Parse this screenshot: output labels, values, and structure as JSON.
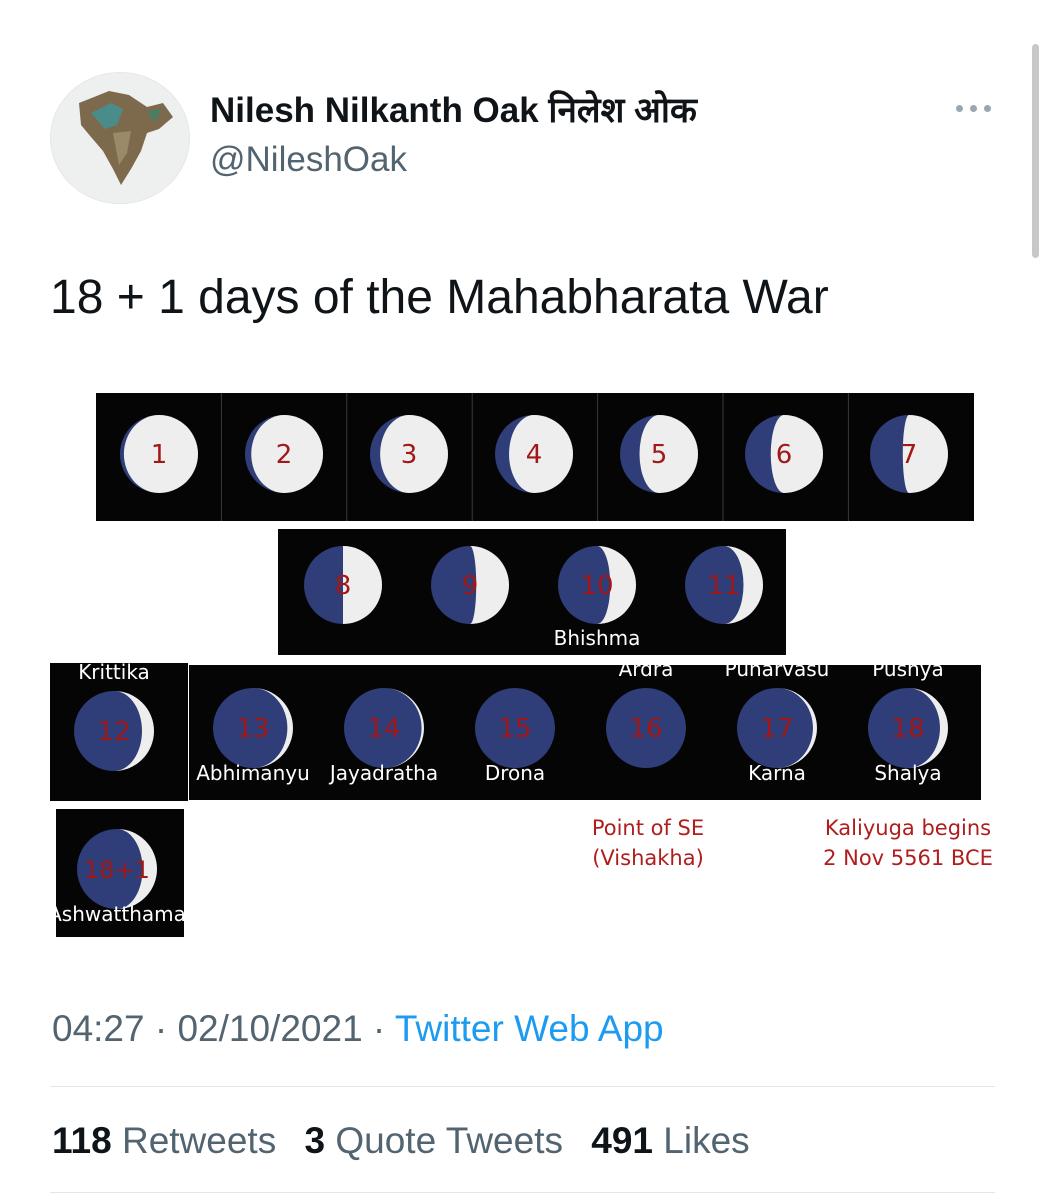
{
  "author": {
    "name": "Nilesh Nilkanth Oak निलेश ओक",
    "handle": "@NileshOak"
  },
  "tweet": {
    "text": "18 + 1 days of the Mahabharata War"
  },
  "image": {
    "moons": [
      {
        "label": "1",
        "phase": 0.05
      },
      {
        "label": "2",
        "phase": 0.08
      },
      {
        "label": "3",
        "phase": 0.13
      },
      {
        "label": "4",
        "phase": 0.18
      },
      {
        "label": "5",
        "phase": 0.25
      },
      {
        "label": "6",
        "phase": 0.33
      },
      {
        "label": "7",
        "phase": 0.42
      },
      {
        "label": "8",
        "phase": 0.5
      },
      {
        "label": "9",
        "phase": 0.58
      },
      {
        "label": "10",
        "phase": 0.67,
        "name_below": "Bhishma"
      },
      {
        "label": "11",
        "phase": 0.75
      },
      {
        "label": "12",
        "phase": 0.85,
        "name_above": "Krittika"
      },
      {
        "label": "13",
        "phase": 0.93,
        "name_below": "Abhimanyu"
      },
      {
        "label": "14",
        "phase": 0.97,
        "name_below": "Jayadratha"
      },
      {
        "label": "15",
        "phase": 1.0,
        "name_below": "Drona"
      },
      {
        "label": "16",
        "phase": 1.0,
        "name_above": "Ardra"
      },
      {
        "label": "17",
        "phase": 0.95,
        "name_above": "Punarvasu",
        "name_below": "Karna"
      },
      {
        "label": "18",
        "phase": 0.9,
        "name_above": "Pushya",
        "name_below": "Shalya"
      },
      {
        "label": "18+1",
        "phase": 0.82,
        "name_below": "Ashwatthama"
      }
    ],
    "notes": {
      "day16_line1": "Point of SE",
      "day16_line2": "(Vishakha)",
      "day18_line1": "Kaliyuga begins",
      "day18_line2": "2 Nov 5561 BCE"
    },
    "colors": {
      "background": "#050505",
      "dark_side": "#2f3d78",
      "lit_side": "#eeeeee",
      "day_number": "#a01818",
      "note_text": "#b01d1d"
    }
  },
  "meta": {
    "time": "04:27 · 02/10/2021 · ",
    "source": "Twitter Web App"
  },
  "stats": {
    "retweets_count": "118",
    "retweets_label": " Retweets",
    "quotes_count": "3",
    "quotes_label": " Quote Tweets",
    "likes_count": "491",
    "likes_label": " Likes"
  },
  "theme": {
    "accent": "#1d9bf0",
    "secondary_text": "#536471"
  }
}
